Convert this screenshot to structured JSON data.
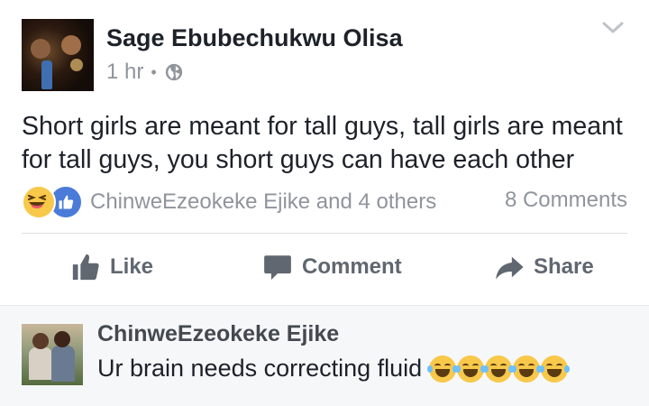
{
  "post": {
    "author": "Sage Ebubechukwu Olisa",
    "time": "1 hr",
    "separator": "•",
    "privacy_icon": "globe-icon",
    "text": "Short girls are meant for tall guys, tall girls are meant for tall guys, you short guys can have each other"
  },
  "reactions": {
    "icons": [
      "haha-reaction-icon",
      "like-reaction-icon"
    ],
    "names": "ChinweEzeokeke Ejike and 4 others",
    "comments_count": "8 Comments"
  },
  "actions": {
    "like": "Like",
    "comment": "Comment",
    "share": "Share"
  },
  "comment": {
    "author": "ChinweEzeokeke Ejike",
    "text": "Ur brain needs correcting fluid",
    "emoji_icon": "tears-of-joy-emoji"
  },
  "colors": {
    "text": "#1d2129",
    "secondary": "#90949c",
    "action": "#606770",
    "like_blue": "#4a7bd8",
    "comment_bg": "#f6f7f9"
  }
}
